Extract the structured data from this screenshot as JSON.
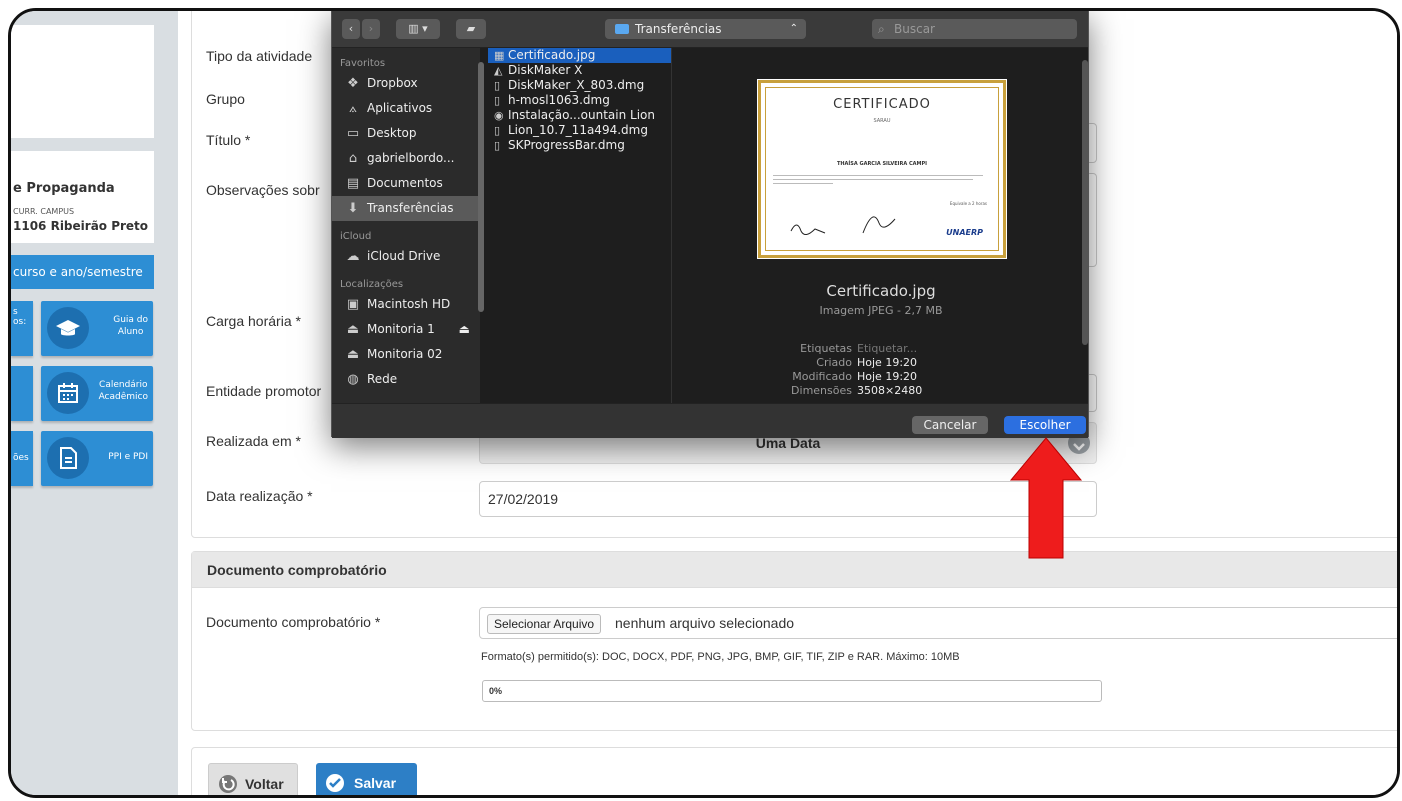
{
  "sidebar": {
    "course_title": "e Propaganda",
    "course_meta": "CURR.  CAMPUS",
    "course_code": "1106 Ribeirão Preto",
    "course_button": "curso e ano/semestre",
    "tiles": [
      {
        "label": "Guia do\nAluno",
        "left_label": "s\nos:"
      },
      {
        "label": "Calendário\nAcadêmico",
        "left_label": ""
      },
      {
        "label": "PPI e PDI",
        "left_label": "ões"
      }
    ]
  },
  "form": {
    "labels": {
      "tipo": "Tipo da atividade",
      "grupo": "Grupo",
      "titulo": "Título *",
      "observacoes": "Observações sobr",
      "carga": "Carga horária *",
      "entidade": "Entidade promotor",
      "realizada": "Realizada em *",
      "data": "Data realização *"
    },
    "realizada_value": "Uma Data",
    "data_value": "27/02/2019"
  },
  "documento": {
    "section_title": "Documento comprobatório",
    "label": "Documento comprobatório *",
    "file_button": "Selecionar Arquivo",
    "file_status": "nenhum arquivo selecionado",
    "formats": "Formato(s) permitido(s): DOC, DOCX, PDF, PNG, JPG, BMP, GIF, TIF, ZIP e RAR. Máximo: 10MB",
    "progress": "0%",
    "progress_value": 0
  },
  "actions": {
    "voltar": "Voltar",
    "salvar": "Salvar"
  },
  "dialog": {
    "location": "Transferências",
    "search_placeholder": "Buscar",
    "sidebar_sections": [
      {
        "title": "Favoritos",
        "items": [
          {
            "label": "Dropbox",
            "icon": "dropbox-icon"
          },
          {
            "label": "Aplicativos",
            "icon": "apps-icon"
          },
          {
            "label": "Desktop",
            "icon": "desktop-icon"
          },
          {
            "label": "gabrielbordo...",
            "icon": "home-icon"
          },
          {
            "label": "Documentos",
            "icon": "documents-icon"
          },
          {
            "label": "Transferências",
            "icon": "downloads-icon",
            "selected": true
          }
        ]
      },
      {
        "title": "iCloud",
        "items": [
          {
            "label": "iCloud Drive",
            "icon": "cloud-icon"
          }
        ]
      },
      {
        "title": "Localizações",
        "items": [
          {
            "label": "Macintosh HD",
            "icon": "disk-icon"
          },
          {
            "label": "Monitoria 1",
            "icon": "drive-icon"
          },
          {
            "label": "Monitoria 02",
            "icon": "drive-icon"
          },
          {
            "label": "Rede",
            "icon": "network-icon"
          }
        ]
      }
    ],
    "files": [
      {
        "name": "Certificado.jpg",
        "selected": true
      },
      {
        "name": "DiskMaker X"
      },
      {
        "name": "DiskMaker_X_803.dmg"
      },
      {
        "name": "h-mosl1063.dmg"
      },
      {
        "name": "Instalação...ountain Lion"
      },
      {
        "name": "Lion_10.7_11a494.dmg"
      },
      {
        "name": "SKProgressBar.dmg"
      }
    ],
    "preview": {
      "cert_title": "CERTIFICADO",
      "cert_subtitle": "SARAU",
      "cert_name": "THAÍSA GARCIA SILVEIRA CAMPI",
      "cert_logo": "UNAERP",
      "cert_hours": "Equivale a 2 horas",
      "name": "Certificado.jpg",
      "type": "Imagem JPEG - 2,7 MB",
      "meta": [
        {
          "k": "Etiquetas",
          "v": "Etiquetar..."
        },
        {
          "k": "Criado",
          "v": "Hoje 19:20"
        },
        {
          "k": "Modificado",
          "v": "Hoje 19:20"
        },
        {
          "k": "Dimensões",
          "v": "3508×2480"
        }
      ]
    },
    "cancel": "Cancelar",
    "choose": "Escolher"
  },
  "colors": {
    "accent": "#2d8ed4",
    "arrow": "#ee1c1c",
    "dialog_select": "#2c6fe0"
  }
}
